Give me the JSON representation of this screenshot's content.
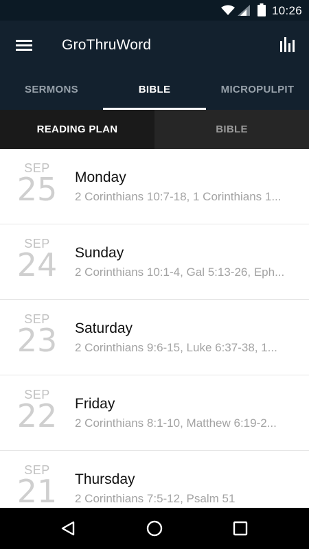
{
  "status_bar": {
    "time": "10:26",
    "icons": [
      "wifi-icon",
      "cell-signal-icon",
      "battery-icon"
    ]
  },
  "app_bar": {
    "title": "GroThruWord",
    "icons": {
      "menu": "hamburger-menu-icon",
      "stats": "bar-chart-icon"
    }
  },
  "tabs": [
    {
      "label": "SERMONS",
      "active": false
    },
    {
      "label": "BIBLE",
      "active": true
    },
    {
      "label": "MICROPULPIT",
      "active": false
    }
  ],
  "subtabs": [
    {
      "label": "READING PLAN",
      "active": true
    },
    {
      "label": "BIBLE",
      "active": false
    }
  ],
  "readings": [
    {
      "month": "SEP",
      "day": "25",
      "weekday": "Monday",
      "passages": "2 Corinthians 10:7-18, 1 Corinthians 1..."
    },
    {
      "month": "SEP",
      "day": "24",
      "weekday": "Sunday",
      "passages": "2 Corinthians 10:1-4, Gal 5:13-26, Eph..."
    },
    {
      "month": "SEP",
      "day": "23",
      "weekday": "Saturday",
      "passages": "2 Corinthians 9:6-15, Luke 6:37-38, 1..."
    },
    {
      "month": "SEP",
      "day": "22",
      "weekday": "Friday",
      "passages": "2 Corinthians 8:1-10, Matthew 6:19-2..."
    },
    {
      "month": "SEP",
      "day": "21",
      "weekday": "Thursday",
      "passages": "2 Corinthians 7:5-12, Psalm 51"
    }
  ],
  "nav_bar": {
    "icons": [
      "back-icon",
      "home-icon",
      "recents-icon"
    ]
  },
  "colors": {
    "status_bar": "#0c1a25",
    "app_bar": "#13212e",
    "tab_active": "#ffffff",
    "tab_inactive": "#97a1aa",
    "subtab_active_bg": "#1a1a1a",
    "subtab_inactive_bg": "#262626",
    "date_text": "#c2c2c2",
    "passage_text": "#a3a3a3"
  }
}
